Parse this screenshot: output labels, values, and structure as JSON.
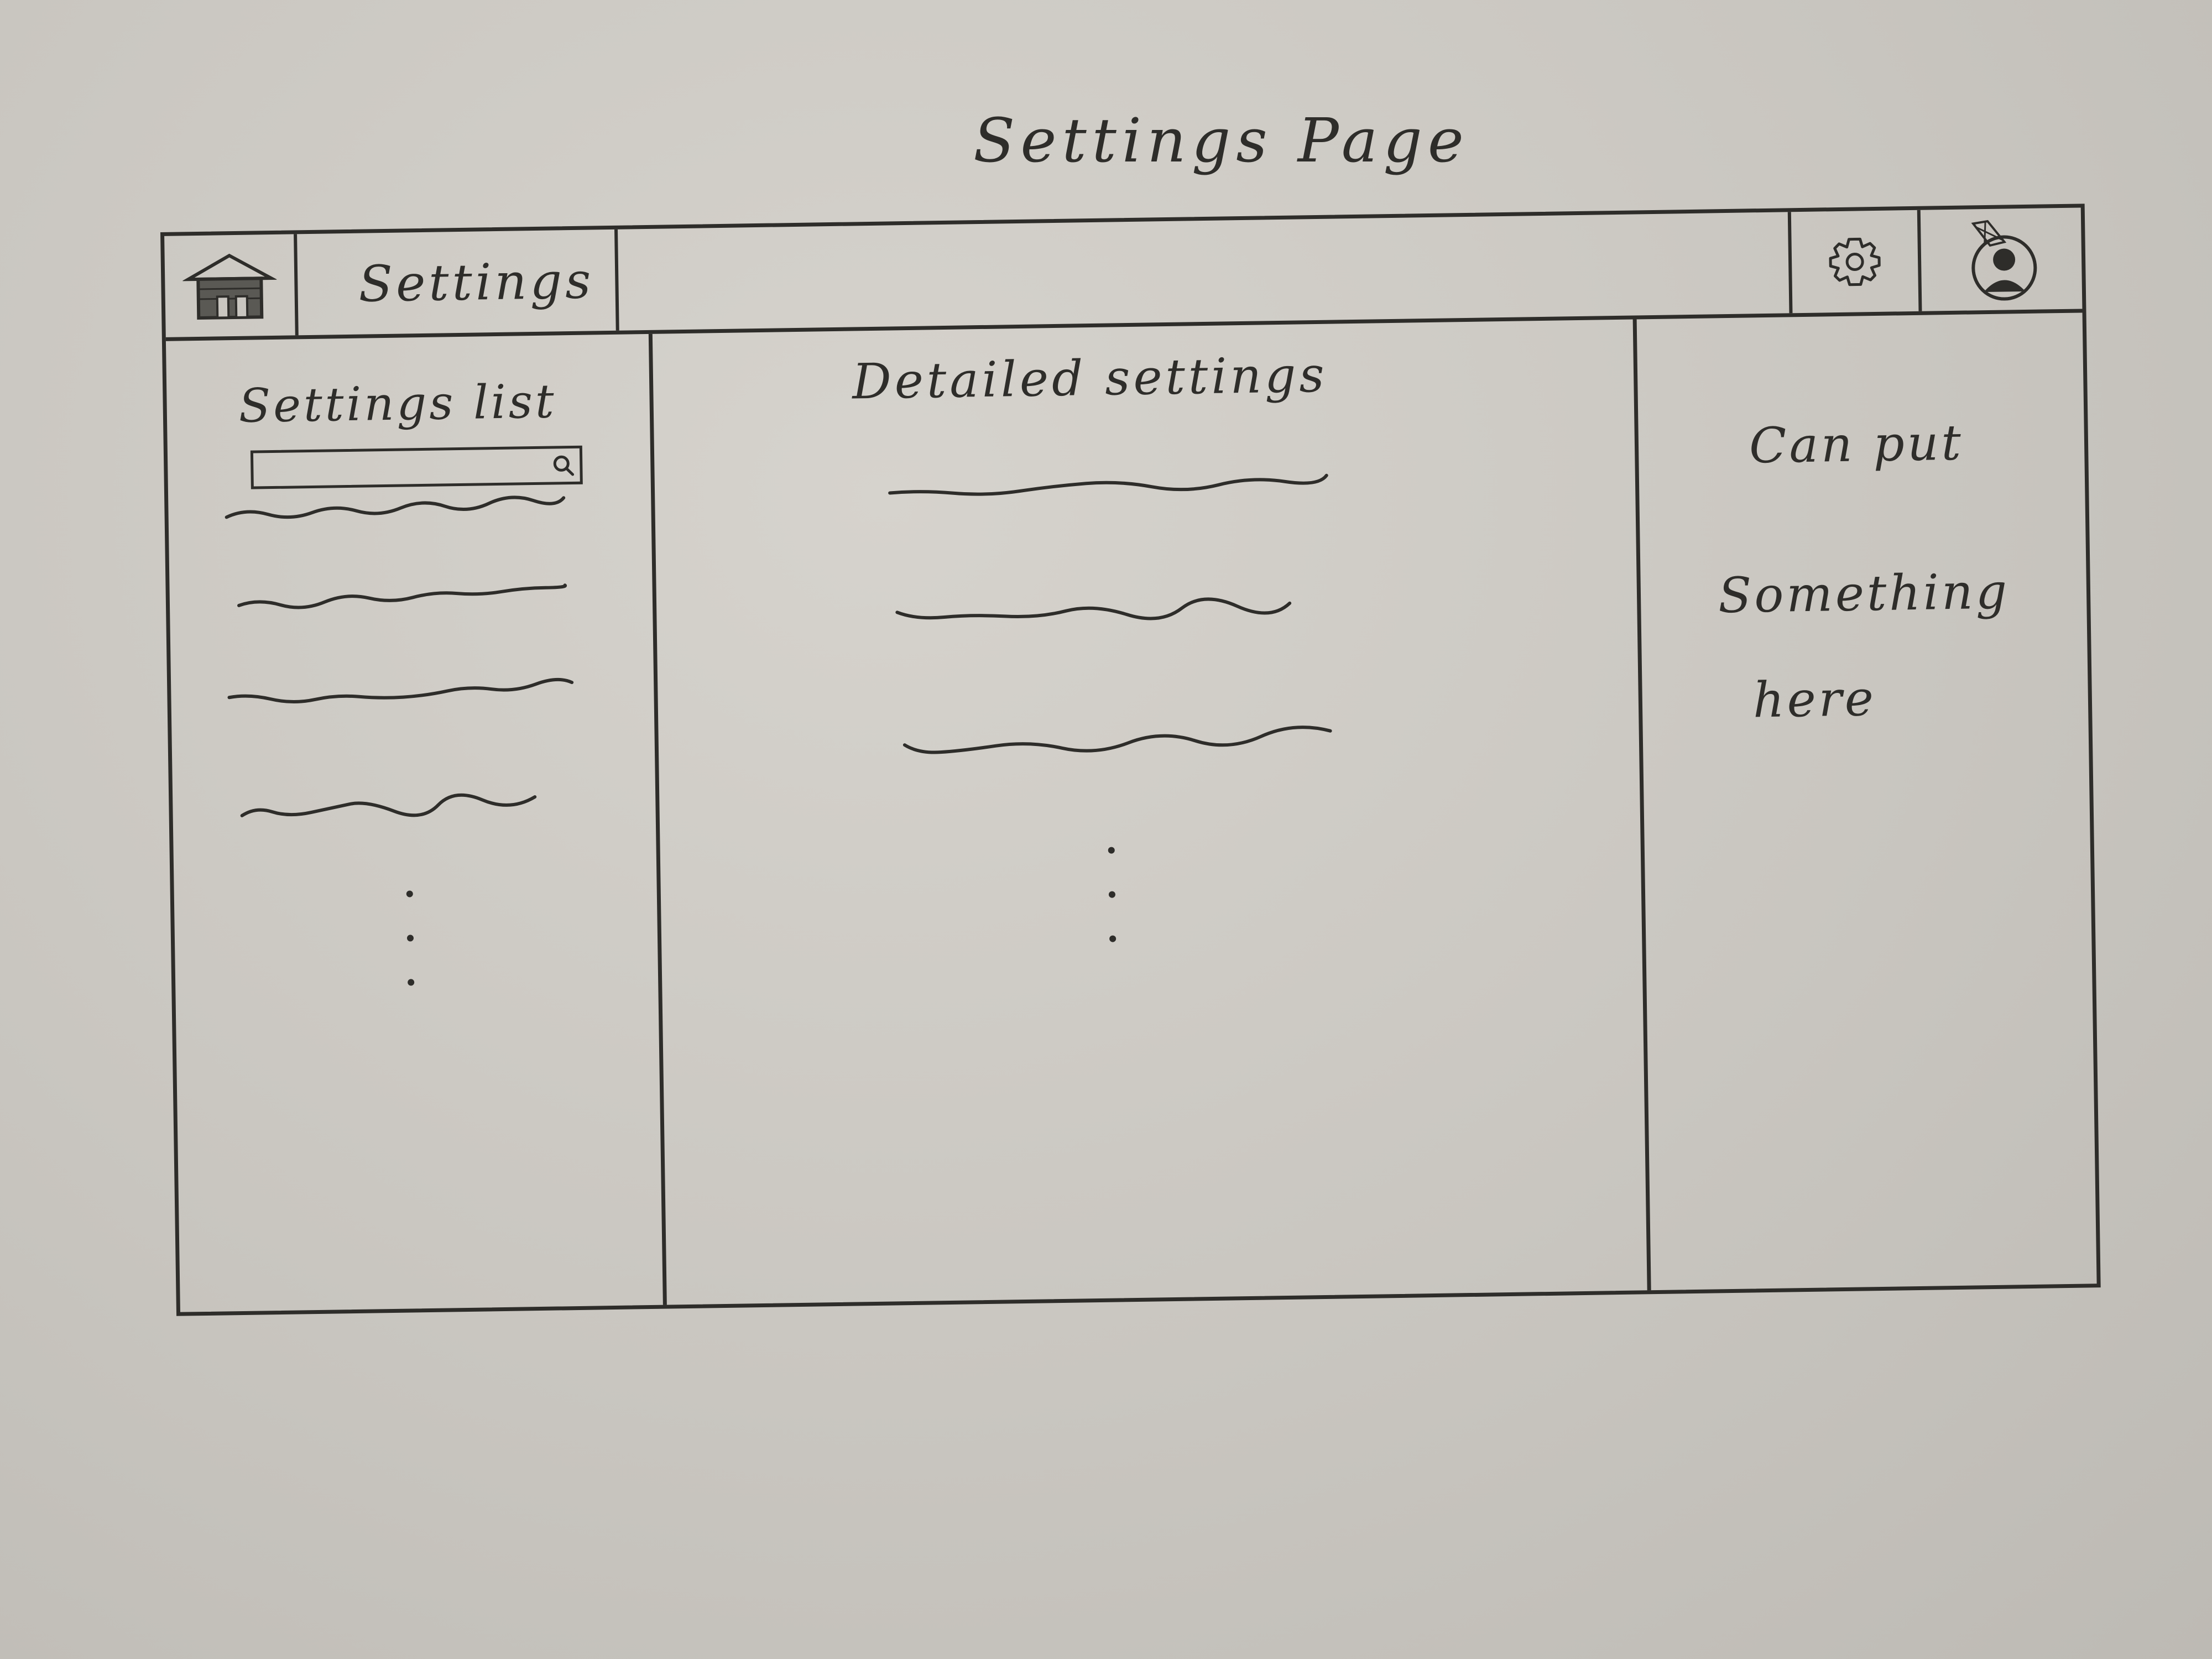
{
  "sheet_title": "Settings Page",
  "topbar": {
    "home_icon": "home-icon",
    "title": "Settings",
    "settings_icon": "gear-icon",
    "profile_icon": "user-avatar-icon"
  },
  "left_pane": {
    "heading": "Settings list",
    "search": {
      "value": "",
      "icon": "search-icon"
    },
    "items_visible": 4
  },
  "main_pane": {
    "heading": "Detailed settings",
    "items_visible": 3
  },
  "right_pane": {
    "note_lines": [
      "Can put",
      "Something",
      "here"
    ]
  }
}
